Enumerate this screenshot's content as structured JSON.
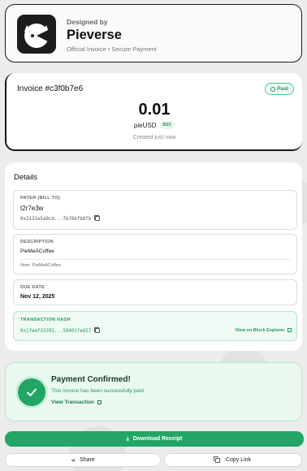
{
  "brand": {
    "designed_by": "Designed by",
    "name": "Pieverse",
    "subtitle": "Official Invoice • Secure Payment"
  },
  "invoice": {
    "id_label": "Invoice #c3f0b7e6",
    "status": "Paid",
    "amount": "0.01",
    "token": "pieUSD",
    "chain": "BSC",
    "created": "Created just now"
  },
  "details": {
    "title": "Details",
    "payer": {
      "label": "PAYER (BILL TO)",
      "name": "t2r7e3w",
      "address": "0x2131e5a9cd...fb76bfb8fb"
    },
    "description": {
      "label": "DESCRIPTION",
      "value": "PieMeACoffee",
      "note": "Note: PieMeACoffee"
    },
    "due_date": {
      "label": "DUE DATE",
      "value": "Nov 12, 2025"
    },
    "transaction": {
      "label": "TRANSACTION HASH",
      "hash": "0x1feef33292...59401fe657",
      "explorer_link": "View on Block Explorer"
    }
  },
  "confirmation": {
    "title": "Payment Confirmed!",
    "message": "This invoice has been successfully paid.",
    "view_link": "View Transaction"
  },
  "actions": {
    "download": "Download Receipt",
    "share": "Share",
    "copy_link": "Copy Link"
  },
  "colors": {
    "accent_green": "#22a565",
    "dark": "#1a1a1a",
    "background": "#ececec"
  },
  "icons": [
    "pieverse-logo",
    "clock-icon",
    "copy-icon",
    "external-link-icon",
    "check-icon",
    "download-icon",
    "share-icon"
  ]
}
